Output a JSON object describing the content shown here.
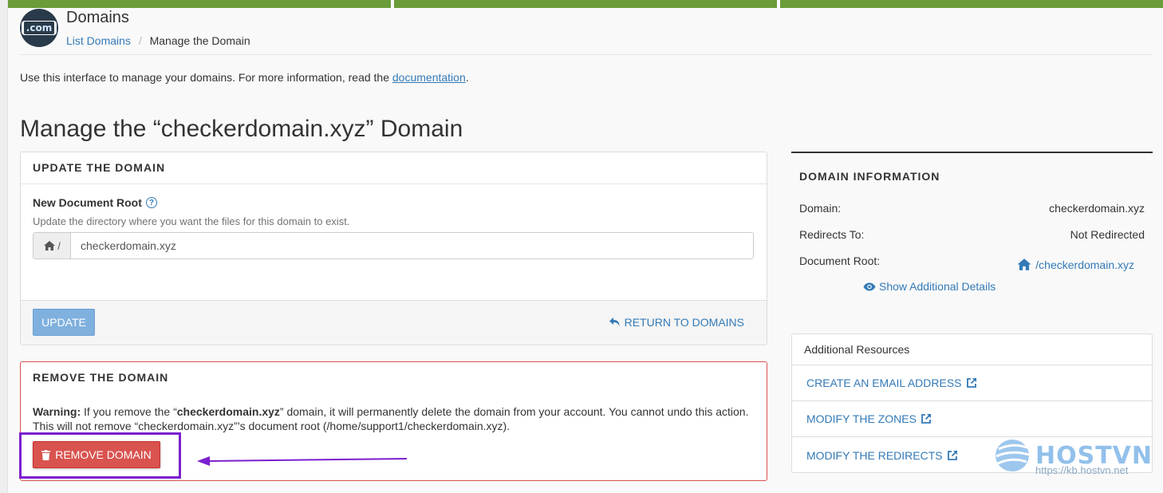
{
  "header": {
    "logo_text": ".com",
    "title": "Domains",
    "breadcrumb": {
      "link": "List Domains",
      "separator": "/",
      "current": "Manage the Domain"
    }
  },
  "intro": {
    "text": "Use this interface to manage your domains. For more information, read the ",
    "link": "documentation",
    "end": "."
  },
  "page_title": "Manage the “checkerdomain.xyz” Domain",
  "update_panel": {
    "heading": "UPDATE THE DOMAIN",
    "label": "New Document Root",
    "help": "Update the directory where you want the files for this domain to exist.",
    "prefix": "/",
    "value": "checkerdomain.xyz",
    "update_button": "UPDATE",
    "return_link": "RETURN TO DOMAINS"
  },
  "remove_panel": {
    "heading": "REMOVE THE DOMAIN",
    "warning_label": "Warning:",
    "warning_pre": " If you remove the “",
    "warning_domain": "checkerdomain.xyz",
    "warning_post": "” domain, it will permanently delete the domain from your account. You cannot undo this action. This will not remove “checkerdomain.xyz”’s document root (/home/support1/checkerdomain.xyz).",
    "remove_button": "REMOVE DOMAIN"
  },
  "domain_info": {
    "heading": "DOMAIN INFORMATION",
    "rows": [
      {
        "label": "Domain:",
        "value": "checkerdomain.xyz"
      },
      {
        "label": "Redirects To:",
        "value": "Not Redirected"
      },
      {
        "label": "Document Root:",
        "value": "/checkerdomain.xyz"
      }
    ],
    "show_details": "Show Additional Details"
  },
  "resources": {
    "heading": "Additional Resources",
    "items": [
      {
        "label": "CREATE AN EMAIL ADDRESS"
      },
      {
        "label": "MODIFY THE ZONES"
      },
      {
        "label": "MODIFY THE REDIRECTS"
      }
    ]
  },
  "watermark": {
    "brand": "HOSTVN",
    "url": "https://kb.hostvn.net"
  },
  "colors": {
    "accent": "#337ab7",
    "danger": "#d9534f",
    "topbar": "#6a9c3a",
    "annotation": "#7b1fcf"
  },
  "icons": [
    "dotcom-logo-icon",
    "question-icon",
    "home-icon",
    "undo-icon",
    "trash-icon",
    "eye-icon",
    "external-link-icon",
    "annotation-arrow-icon"
  ]
}
